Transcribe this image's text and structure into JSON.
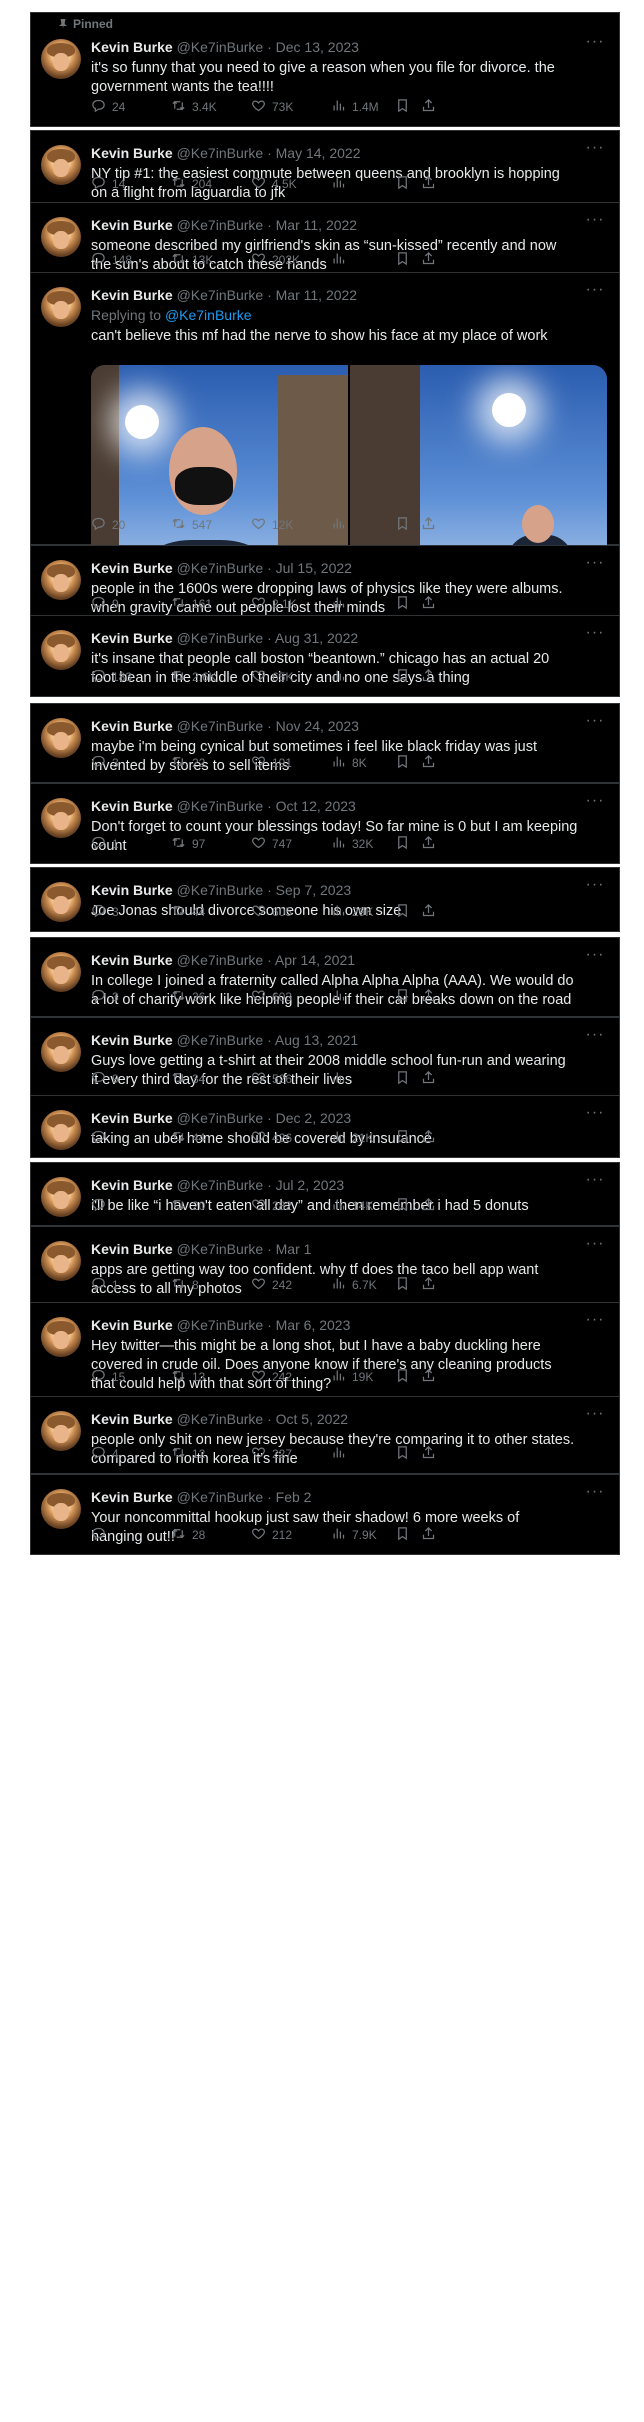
{
  "profile": {
    "name": "Kevin Burke",
    "handle": "@Ke7inBurke"
  },
  "pinned_label": "Pinned",
  "colors": {
    "background": "#000000",
    "text": "#e7e9ea",
    "muted": "#71767b",
    "link": "#1d9bf0"
  },
  "icons": {
    "reply": "reply-icon",
    "retweet": "retweet-icon",
    "like": "heart-icon",
    "views": "views-icon",
    "bookmark": "bookmark-icon",
    "share": "share-icon",
    "more": "more-icon",
    "pin": "pin-icon"
  },
  "tweets": [
    {
      "date": "Dec 13, 2023",
      "text": [
        "it's so funny that you need to give a reason when you file for divorce. the",
        "government wants the tea!!!!"
      ],
      "replies": "24",
      "retweets": "3.4K",
      "likes": "73K",
      "views": "1.4M"
    },
    {
      "date": "May 14, 2022",
      "text": [
        "NY tip #1: the easiest commute between queens and brooklyn is hopping",
        "on a flight from laguardia to jfk"
      ],
      "replies": "14",
      "retweets": "204",
      "likes": "4.5K",
      "views": ""
    },
    {
      "date": "Mar 11, 2022",
      "text": [
        "someone described my girlfriend's skin as “sun-kissed” recently and now",
        "the sun's about to catch these hands"
      ],
      "replies": "148",
      "retweets": "13K",
      "likes": "202K",
      "views": ""
    },
    {
      "date": "Mar 11, 2022",
      "reply_to_prefix": "Replying to",
      "reply_to_handle": "@Ke7inBurke",
      "text": [
        "can't believe this mf had the nerve to show his face at my place of work"
      ],
      "replies": "20",
      "retweets": "547",
      "likes": "12K",
      "views": ""
    },
    {
      "date": "Jul 15, 2022",
      "text": [
        "people in the 1600s were dropping laws of physics like they were albums.",
        "when gravity came out people lost their minds"
      ],
      "replies": "9",
      "retweets": "161",
      "likes": "2.1K",
      "views": ""
    },
    {
      "date": "Aug 31, 2022",
      "text": [
        "it's insane that people call boston “beantown.” chicago has an actual 20",
        "foot bean in the middle of their city and no one says a thing"
      ],
      "replies": "183",
      "retweets": "2.6K",
      "likes": "65K",
      "views": ""
    },
    {
      "date": "Nov 24, 2023",
      "text": [
        "maybe i'm being cynical but sometimes i feel like black friday was just",
        "invented by stores to sell items"
      ],
      "replies": "3",
      "retweets": "22",
      "likes": "191",
      "views": "8K"
    },
    {
      "date": "Oct 12, 2023",
      "text": [
        "Don't forget to count your blessings today! So far mine is 0 but I am keeping",
        "count"
      ],
      "replies": "1",
      "retweets": "97",
      "likes": "747",
      "views": "32K"
    },
    {
      "date": "Sep 7, 2023",
      "text": [
        "Joe Jonas should divorce someone his own size"
      ],
      "replies": "3",
      "retweets": "44",
      "likes": "605",
      "views": "29K"
    },
    {
      "date": "Apr 14, 2021",
      "text": [
        "In college I joined a fraternity called Alpha Alpha Alpha (AAA). We would do",
        "a lot of charity work like helping people if their car breaks down on the road"
      ],
      "replies": "3",
      "retweets": "26",
      "likes": "603",
      "views": ""
    },
    {
      "date": "Aug 13, 2021",
      "text": [
        "Guys love getting a t-shirt at their 2008 middle school fun-run and wearing",
        "it every third day for the rest of their lives"
      ],
      "replies": "9",
      "retweets": "34",
      "likes": "526",
      "views": ""
    },
    {
      "date": "Dec 2, 2023",
      "text": [
        "taking an uber home should be covered by insurance"
      ],
      "replies": "",
      "retweets": "44",
      "likes": "426",
      "views": "21K"
    },
    {
      "date": "Jul 2, 2023",
      "text": [
        "i'll be like “i haven't eaten all day” and then remember i had 5 donuts"
      ],
      "replies": "",
      "retweets": "20",
      "likes": "282",
      "views": "14K"
    },
    {
      "date": "Mar 1",
      "text": [
        "apps are getting way too confident. why tf does the taco bell app want",
        "access to all my photos"
      ],
      "replies": "1",
      "retweets": "8",
      "likes": "242",
      "views": "6.7K"
    },
    {
      "date": "Mar 6, 2023",
      "text": [
        "Hey twitter—this might be a long shot, but I have a baby duckling here",
        "covered in crude oil. Does anyone know if there's any cleaning products",
        "that could help with that sort of thing?"
      ],
      "replies": "15",
      "retweets": "13",
      "likes": "242",
      "views": "19K"
    },
    {
      "date": "Oct 5, 2022",
      "text": [
        "people only shit on new jersey because they're comparing it to other states.",
        "compared to north korea it's fine"
      ],
      "replies": "4",
      "retweets": "12",
      "likes": "227",
      "views": ""
    },
    {
      "date": "Feb 2",
      "text": [
        "Your noncommittal hookup just saw their shadow! 6 more weeks of",
        "hanging out!!"
      ],
      "replies": "",
      "retweets": "28",
      "likes": "212",
      "views": "7.9K"
    }
  ]
}
